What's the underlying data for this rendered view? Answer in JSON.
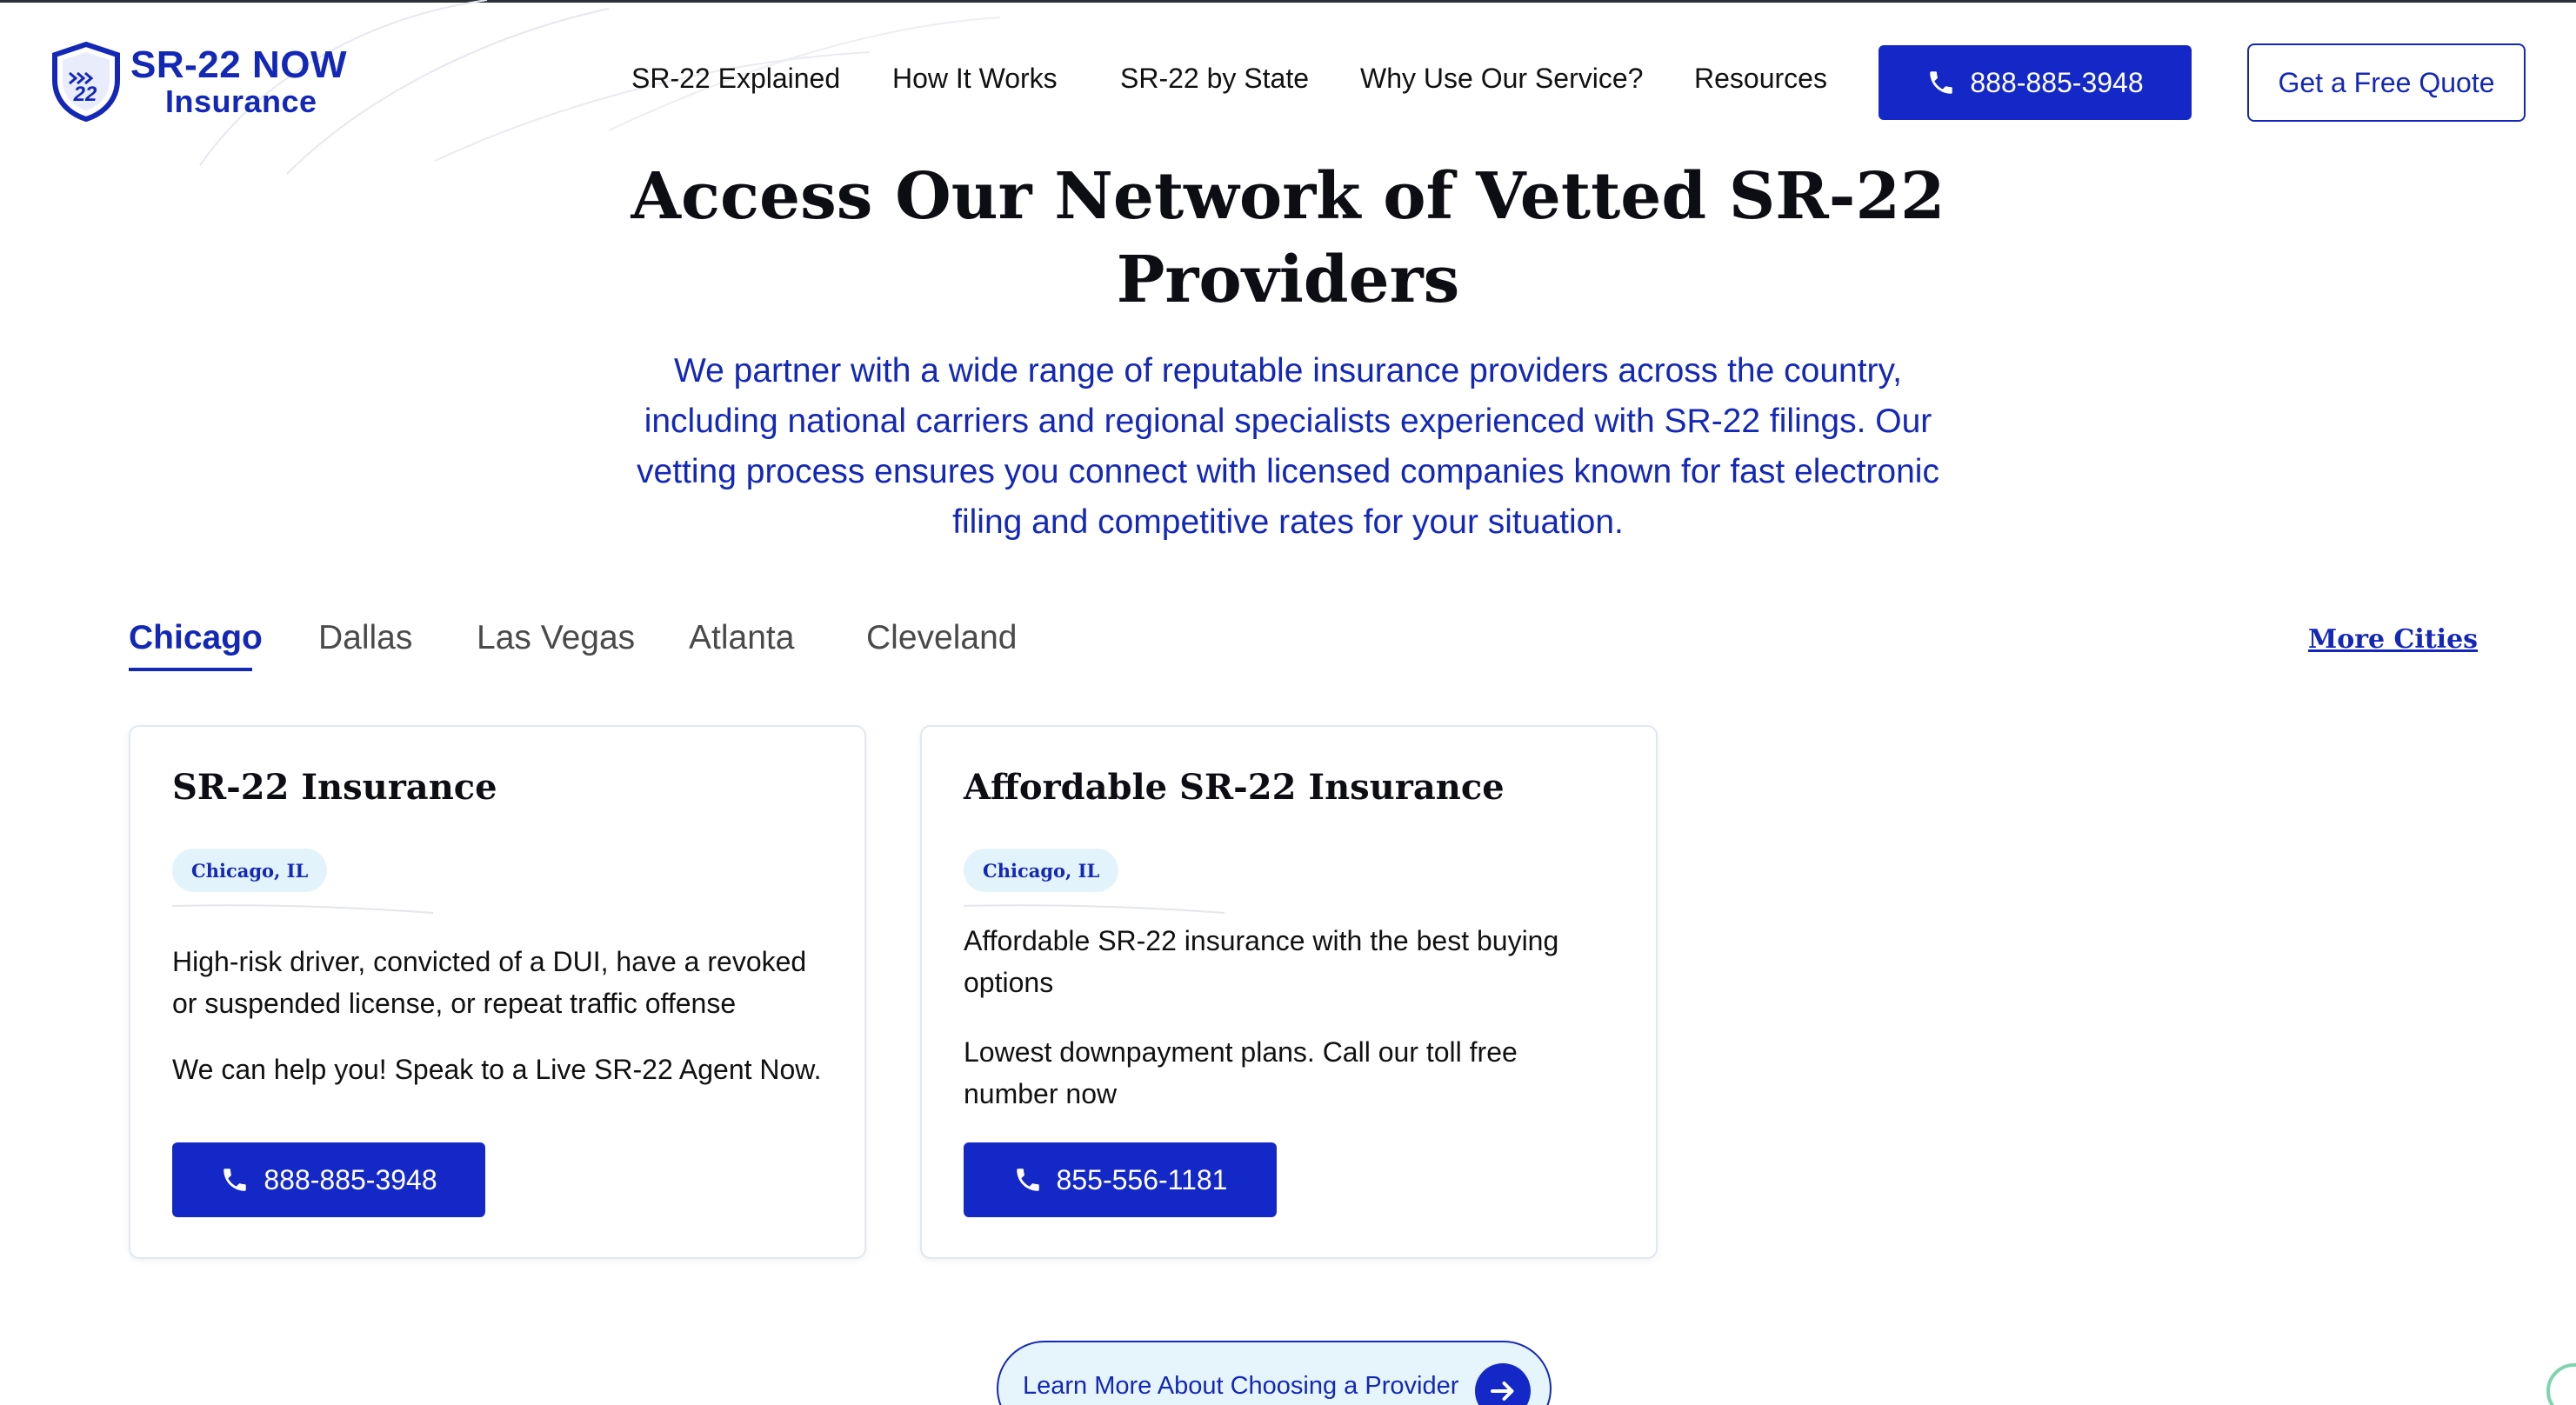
{
  "brand": {
    "logo_top": "SR-22 NOW",
    "logo_bottom": "Insurance",
    "shield_mark": "22",
    "primary_color": "#1428c8",
    "badge_bg": "#e2f3fb"
  },
  "nav": {
    "items": [
      {
        "label": "SR-22 Explained"
      },
      {
        "label": "How It Works"
      },
      {
        "label": "SR-22 by State"
      },
      {
        "label": "Why Use Our Service?"
      },
      {
        "label": "Resources"
      }
    ],
    "phone": "888-885-3948",
    "quote_label": "Get a Free Quote"
  },
  "hero": {
    "title_line1": "Access Our Network of Vetted SR-22",
    "title_line2": "Providers",
    "subtitle_lines": [
      "We partner with a wide range of reputable insurance providers across the country,",
      "including national carriers and regional specialists experienced with SR-22 filings. Our",
      "vetting process ensures you connect with licensed companies known for fast electronic",
      "filing and competitive rates for your situation."
    ]
  },
  "cities": {
    "tabs": [
      {
        "label": "Chicago",
        "active": true
      },
      {
        "label": "Dallas",
        "active": false
      },
      {
        "label": "Las Vegas",
        "active": false
      },
      {
        "label": "Atlanta",
        "active": false
      },
      {
        "label": "Cleveland",
        "active": false
      }
    ],
    "more_label": "More Cities"
  },
  "cards": [
    {
      "title": "SR-22 Insurance",
      "location": "Chicago,  IL",
      "lines_a": [
        "High-risk driver, convicted of a DUI, have a revoked",
        "or suspended license, or repeat traffic offense"
      ],
      "lines_b": [
        "We can help you! Speak to a Live SR-22 Agent Now."
      ],
      "phone": "888-885-3948"
    },
    {
      "title": "Affordable SR-22 Insurance",
      "location": "Chicago,  IL",
      "lines_a": [
        "Affordable SR-22 insurance with the best buying",
        "options"
      ],
      "lines_b": [
        "Lowest downpayment plans. Call our toll free",
        "number now"
      ],
      "phone": "855-556-1181"
    }
  ],
  "learn_more": {
    "label": "Learn More About Choosing a Provider",
    "icon": "arrow-right-icon"
  }
}
